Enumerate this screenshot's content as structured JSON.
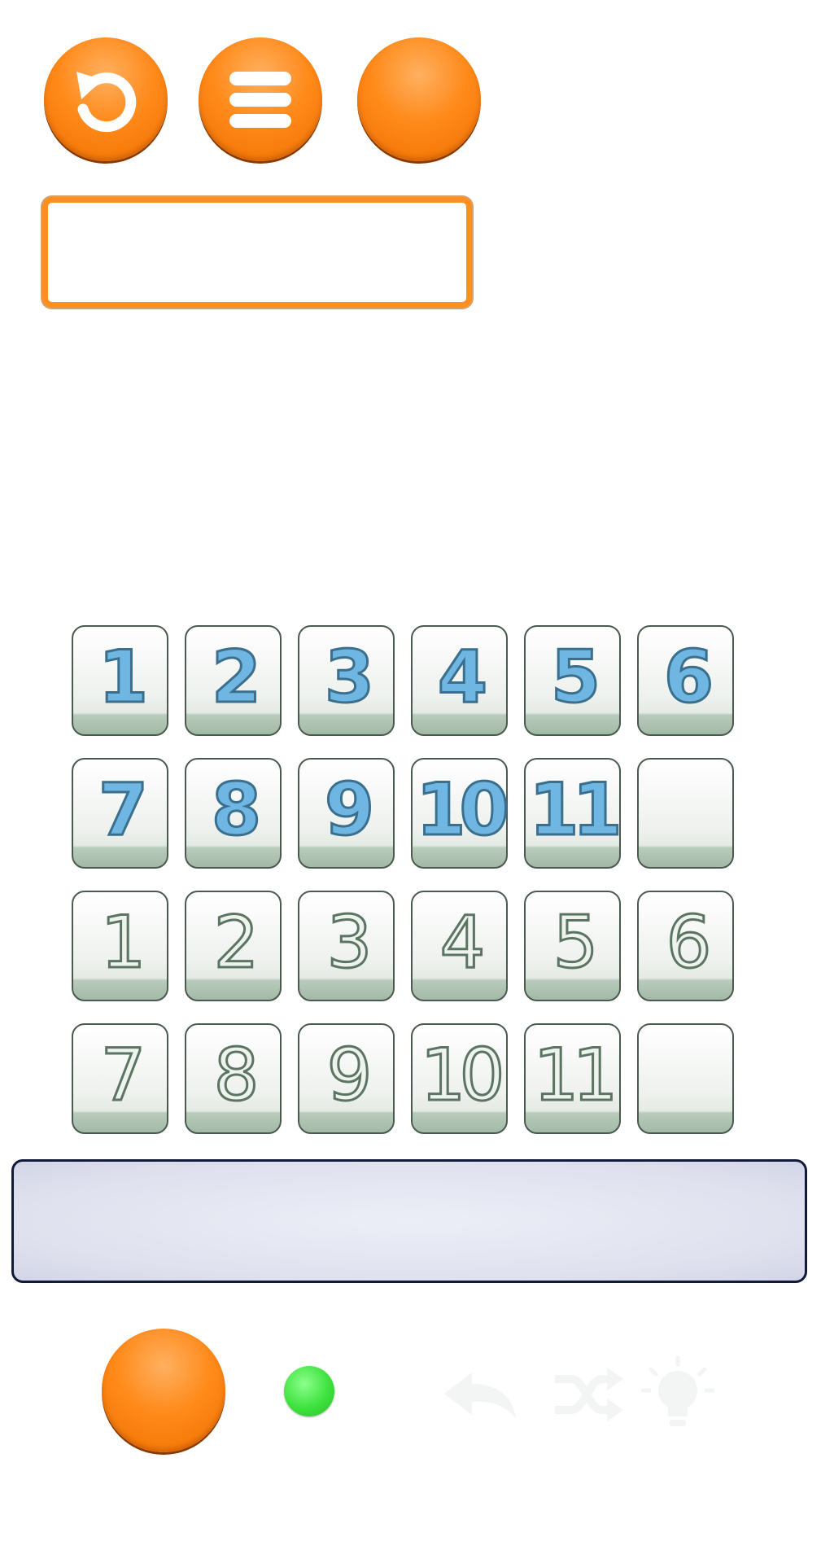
{
  "top_controls": {
    "restart_icon": "restart-icon",
    "menu_icon": "menu-icon",
    "blank_button_label": ""
  },
  "score_box": {
    "text": ""
  },
  "tiles": {
    "blue_set": [
      "1",
      "2",
      "3",
      "4",
      "5",
      "6",
      "7",
      "8",
      "9",
      "10",
      "11",
      ""
    ],
    "outline_set": [
      "1",
      "2",
      "3",
      "4",
      "5",
      "6",
      "7",
      "8",
      "9",
      "10",
      "11",
      ""
    ]
  },
  "message_bar": {
    "text": ""
  },
  "bottom_controls": {
    "orange_button_label": "",
    "status_dot_color": "#3ee23e",
    "undo_icon": "undo-icon",
    "shuffle_icon": "shuffle-icon",
    "hint_icon": "lightbulb-icon"
  },
  "colors": {
    "accent": "#ff8a1a",
    "tile_number_blue": "#6fb7e2",
    "message_bar_bg": "#dfe1ee"
  }
}
